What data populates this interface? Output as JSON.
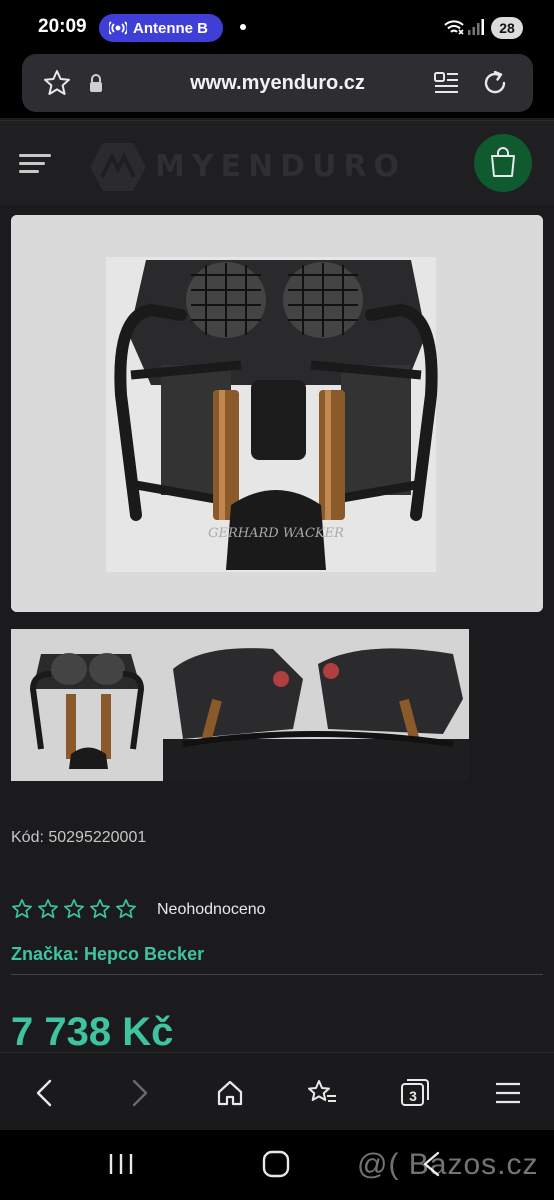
{
  "status_bar": {
    "time": "20:09",
    "media_pill": "Antenne B",
    "battery": "28"
  },
  "url_bar": {
    "url": "www.myenduro.cz"
  },
  "site": {
    "logo_text": "MYENDURO",
    "accent_color": "#3ec4a1",
    "cart_color": "#0f5a2e"
  },
  "product": {
    "code": "Kód: 50295220001",
    "rating_text": "Neohodnoceno",
    "stars_filled": 0,
    "stars_total": 5,
    "brand": "Značka: Hepco Becker",
    "price": "7 738 Kč",
    "image_caption": "GERHARD WACKER"
  },
  "toolbar": {
    "tabs_count": "3",
    "icons": [
      "back-icon",
      "forward-icon",
      "home-icon",
      "bookmarks-icon",
      "tabs-icon",
      "menu-icon"
    ]
  },
  "watermark": "@( Bazos.cz"
}
